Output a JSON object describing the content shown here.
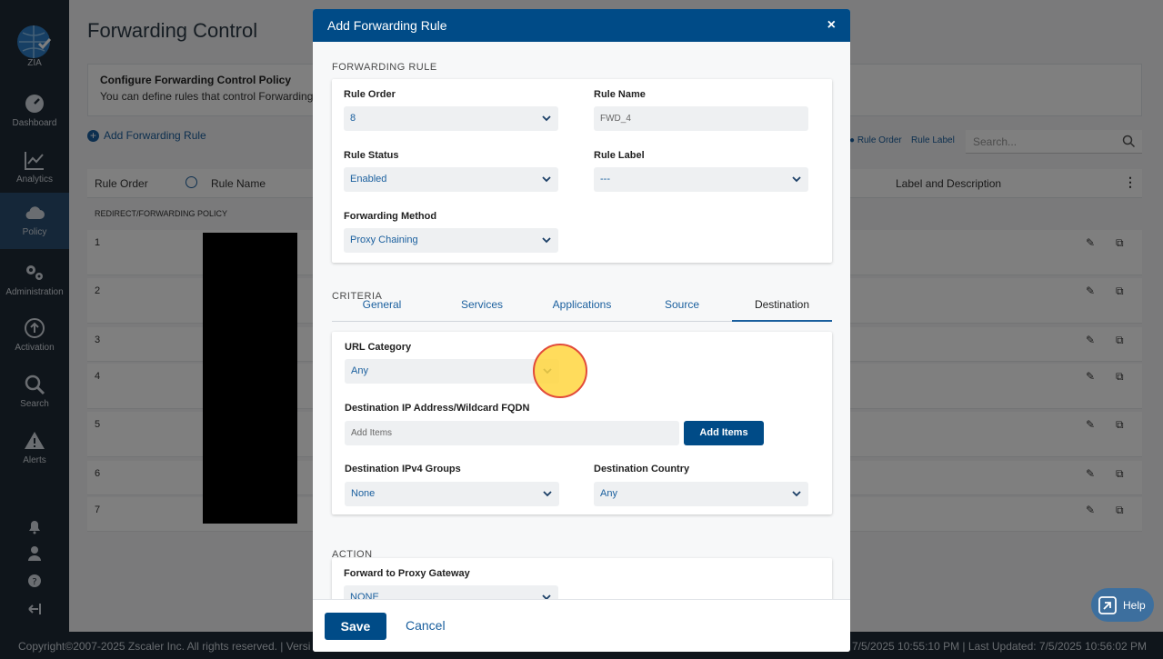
{
  "sidebar": {
    "logo_label": "ZIA",
    "items": [
      {
        "label": "Dashboard"
      },
      {
        "label": "Analytics"
      },
      {
        "label": "Policy"
      },
      {
        "label": "Administration"
      },
      {
        "label": "Activation"
      },
      {
        "label": "Search"
      },
      {
        "label": "Alerts"
      }
    ]
  },
  "page": {
    "title": "Forwarding Control",
    "info_title": "Configure Forwarding Control Policy",
    "info_text": "You can define rules that control Forwarding",
    "add_rule": "Add Forwarding Rule",
    "toolbar_rule_order": "Rule Order",
    "toolbar_rule_label": "Rule Label",
    "search_placeholder": "Search...",
    "columns": {
      "rule_order": "Rule Order",
      "rule_name": "Rule Name",
      "label_desc": "Label and Description"
    },
    "section": "REDIRECT/FORWARDING POLICY",
    "rows": [
      "1",
      "2",
      "3",
      "4",
      "5",
      "6",
      "7"
    ]
  },
  "footer": {
    "left": "Copyright©2007-2025 Zscaler Inc. All rights reserved.  |  Versi",
    "right": "7/5/2025 10:55:10 PM  |  Last Updated: 7/5/2025 10:56:02 PM"
  },
  "modal": {
    "title": "Add Forwarding Rule",
    "close": "×",
    "forwarding_rule_section": "FORWARDING RULE",
    "rule_order_label": "Rule Order",
    "rule_order_value": "8",
    "rule_name_label": "Rule Name",
    "rule_name_value": "FWD_4",
    "rule_status_label": "Rule Status",
    "rule_status_value": "Enabled",
    "rule_label_label": "Rule Label",
    "rule_label_value": "---",
    "forwarding_method_label": "Forwarding Method",
    "forwarding_method_value": "Proxy Chaining",
    "criteria_section": "CRITERIA",
    "tabs": [
      "General",
      "Services",
      "Applications",
      "Source",
      "Destination"
    ],
    "url_category_label": "URL Category",
    "url_category_value": "Any",
    "dest_ip_label": "Destination IP Address/Wildcard FQDN",
    "dest_ip_placeholder": "Add Items",
    "add_items_button": "Add Items",
    "ipv4_groups_label": "Destination IPv4 Groups",
    "ipv4_groups_value": "None",
    "dest_country_label": "Destination Country",
    "dest_country_value": "Any",
    "action_section": "ACTION",
    "proxy_gateway_label": "Forward to Proxy Gateway",
    "proxy_gateway_value": "NONE",
    "save": "Save",
    "cancel": "Cancel"
  },
  "help": {
    "label": "Help"
  }
}
